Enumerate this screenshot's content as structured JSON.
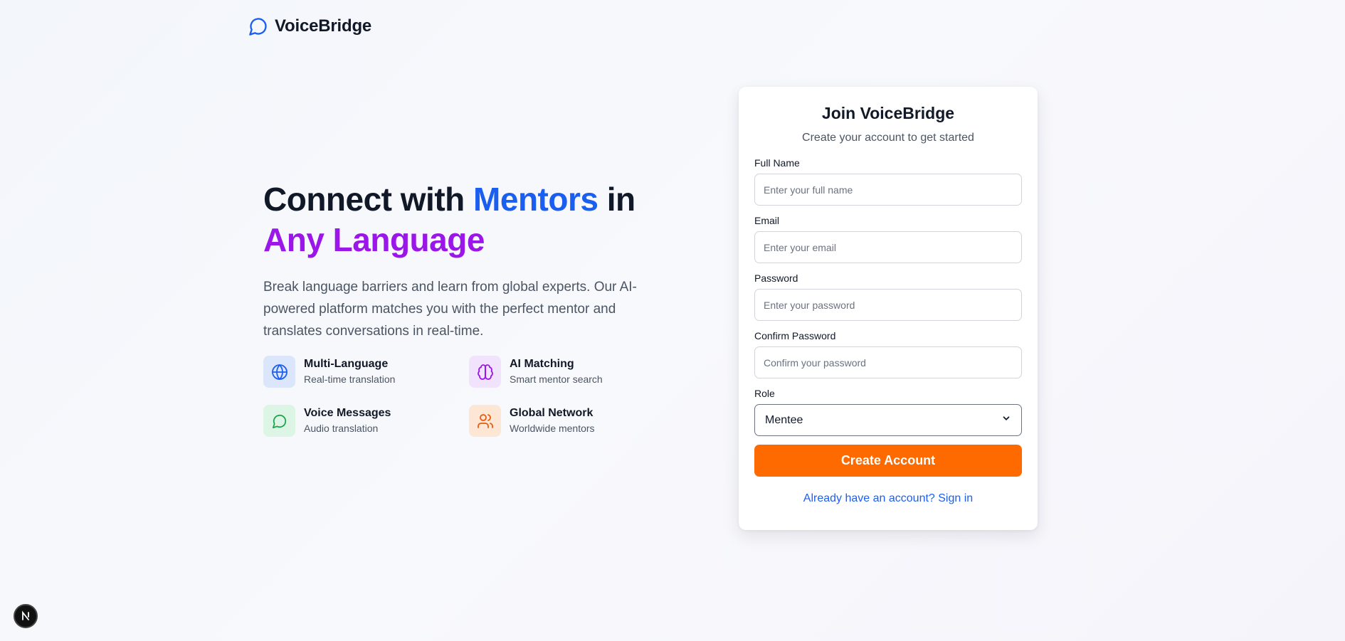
{
  "brand": {
    "name": "VoiceBridge",
    "icon": "message-circle-icon",
    "accent": "#1a5ff0"
  },
  "hero": {
    "headline_part1": "Connect with ",
    "headline_highlight1": "Mentors",
    "headline_part2": " in",
    "headline_highlight2": "Any Language",
    "description": "Break language barriers and learn from global experts. Our AI-powered platform matches you with the perfect mentor and translates conversations in real-time.",
    "colors": {
      "blue": "#1a5ff0",
      "purple": "#9b16e8"
    }
  },
  "features": [
    {
      "title": "Multi-Language",
      "subtitle": "Real-time translation",
      "icon": "globe-icon",
      "color": "#1a5ff0",
      "bg": "#dbe6fb"
    },
    {
      "title": "AI Matching",
      "subtitle": "Smart mentor search",
      "icon": "brain-icon",
      "color": "#9b16e8",
      "bg": "#f1e3fb"
    },
    {
      "title": "Voice Messages",
      "subtitle": "Audio translation",
      "icon": "message-circle-icon",
      "color": "#16a34a",
      "bg": "#dcf5e4"
    },
    {
      "title": "Global Network",
      "subtitle": "Worldwide mentors",
      "icon": "users-icon",
      "color": "#ea580c",
      "bg": "#fde6d3"
    }
  ],
  "signup": {
    "title": "Join VoiceBridge",
    "subtitle": "Create your account to get started",
    "fields": {
      "full_name": {
        "label": "Full Name",
        "placeholder": "Enter your full name",
        "value": ""
      },
      "email": {
        "label": "Email",
        "placeholder": "Enter your email",
        "value": ""
      },
      "password": {
        "label": "Password",
        "placeholder": "Enter your password",
        "value": ""
      },
      "confirm_password": {
        "label": "Confirm Password",
        "placeholder": "Confirm your password",
        "value": ""
      }
    },
    "role": {
      "label": "Role",
      "selected": "Mentee"
    },
    "submit_label": "Create Account",
    "submit_color": "#ff6a00",
    "signin_link": "Already have an account? Sign in"
  },
  "dev_badge": {
    "letter": "N",
    "icon": "nextjs-icon"
  }
}
